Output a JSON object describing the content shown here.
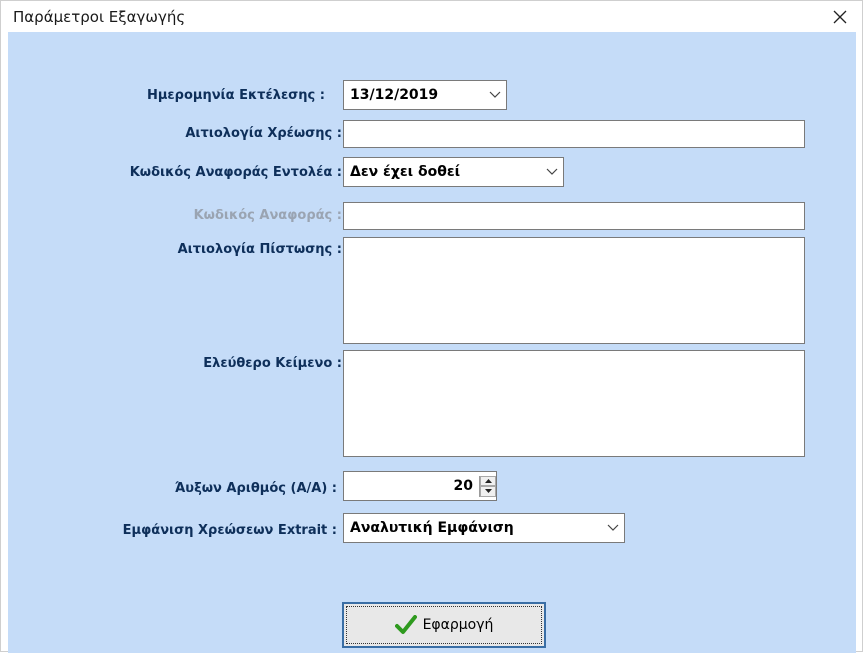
{
  "window": {
    "title": "Παράμετροι Εξαγωγής"
  },
  "fields": {
    "execution_date": {
      "label": "Ημερομηνία Εκτέλεσης :",
      "value": "13/12/2019"
    },
    "debit_reason": {
      "label": "Αιτιολογία Χρέωσης :",
      "value": ""
    },
    "originator_ref_code": {
      "label": "Κωδικός Αναφοράς Εντολέα :",
      "value": "Δεν έχει δοθεί"
    },
    "ref_code": {
      "label": "Κωδικός Αναφοράς :",
      "value": ""
    },
    "credit_reason": {
      "label": "Αιτιολογία Πίστωσης :",
      "value": ""
    },
    "free_text": {
      "label": "Ελεύθερο Κείμενο :",
      "value": ""
    },
    "serial_number": {
      "label": "Άυξων Αριθμός (Α/Α) :",
      "value": "20"
    },
    "extrait_display": {
      "label": "Εμφάνιση Χρεώσεων Extrait :",
      "value": "Αναλυτική Εμφάνιση"
    }
  },
  "buttons": {
    "apply": "Εφαρμογή"
  },
  "colors": {
    "client_bg": "#c5dcf8",
    "label_text": "#0e2f5a",
    "check_green": "#2e9a1e"
  }
}
